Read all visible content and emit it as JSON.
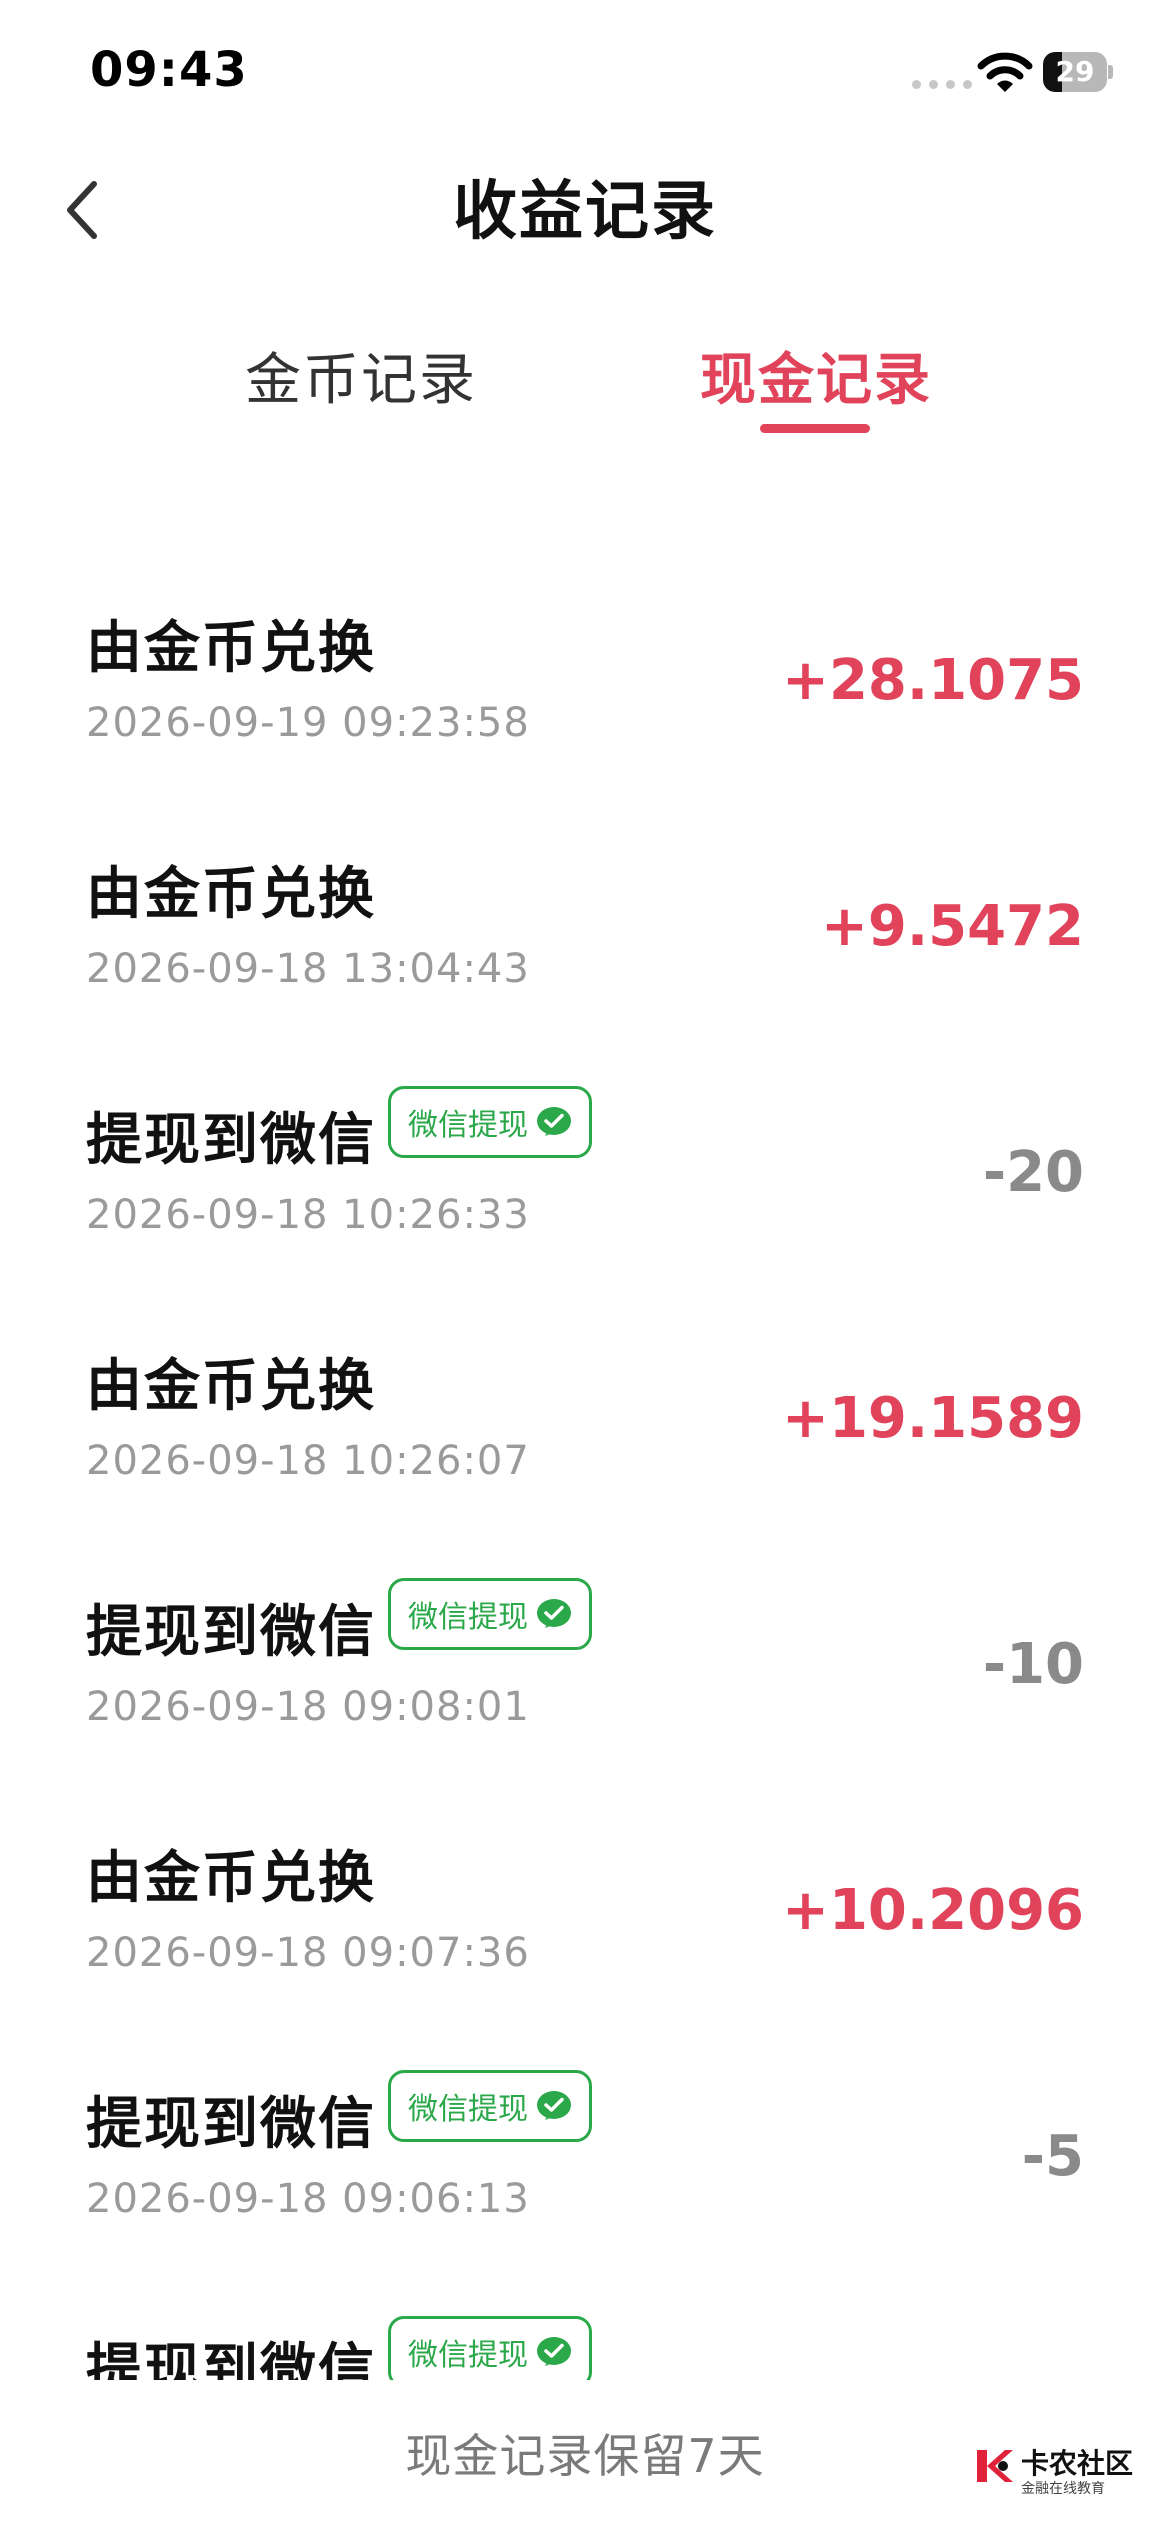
{
  "status_bar": {
    "time": "09:43",
    "battery": "29",
    "battery_level": 0.29
  },
  "header": {
    "title": "收益记录"
  },
  "tabs": [
    {
      "label": "金币记录",
      "active": false
    },
    {
      "label": "现金记录",
      "active": true
    }
  ],
  "records": [
    {
      "title": "由金币兑换",
      "date": "2026-09-19 09:23:58",
      "amount": "+28.1075",
      "badge": ""
    },
    {
      "title": "由金币兑换",
      "date": "2026-09-18 13:04:43",
      "amount": "+9.5472",
      "badge": ""
    },
    {
      "title": "提现到微信",
      "date": "2026-09-18 10:26:33",
      "amount": "-20",
      "badge": "微信提现"
    },
    {
      "title": "由金币兑换",
      "date": "2026-09-18 10:26:07",
      "amount": "+19.1589",
      "badge": ""
    },
    {
      "title": "提现到微信",
      "date": "2026-09-18 09:08:01",
      "amount": "-10",
      "badge": "微信提现"
    },
    {
      "title": "由金币兑换",
      "date": "2026-09-18 09:07:36",
      "amount": "+10.2096",
      "badge": ""
    },
    {
      "title": "提现到微信",
      "date": "2026-09-18 09:06:13",
      "amount": "-5",
      "badge": "微信提现"
    },
    {
      "title": "提现到微信",
      "date": "",
      "amount": "",
      "badge": "微信提现"
    }
  ],
  "footer": {
    "note": "现金记录保留7天"
  },
  "watermark": {
    "name": "卡农社区",
    "sub": "金融在线教育"
  },
  "colors": {
    "accent": "#e0435a",
    "badge_green": "#2aa84a",
    "muted": "#9a9a9a"
  },
  "icons": {
    "back": "chevron-left-icon",
    "badge": "wechat-check-icon",
    "wifi": "wifi-icon"
  }
}
